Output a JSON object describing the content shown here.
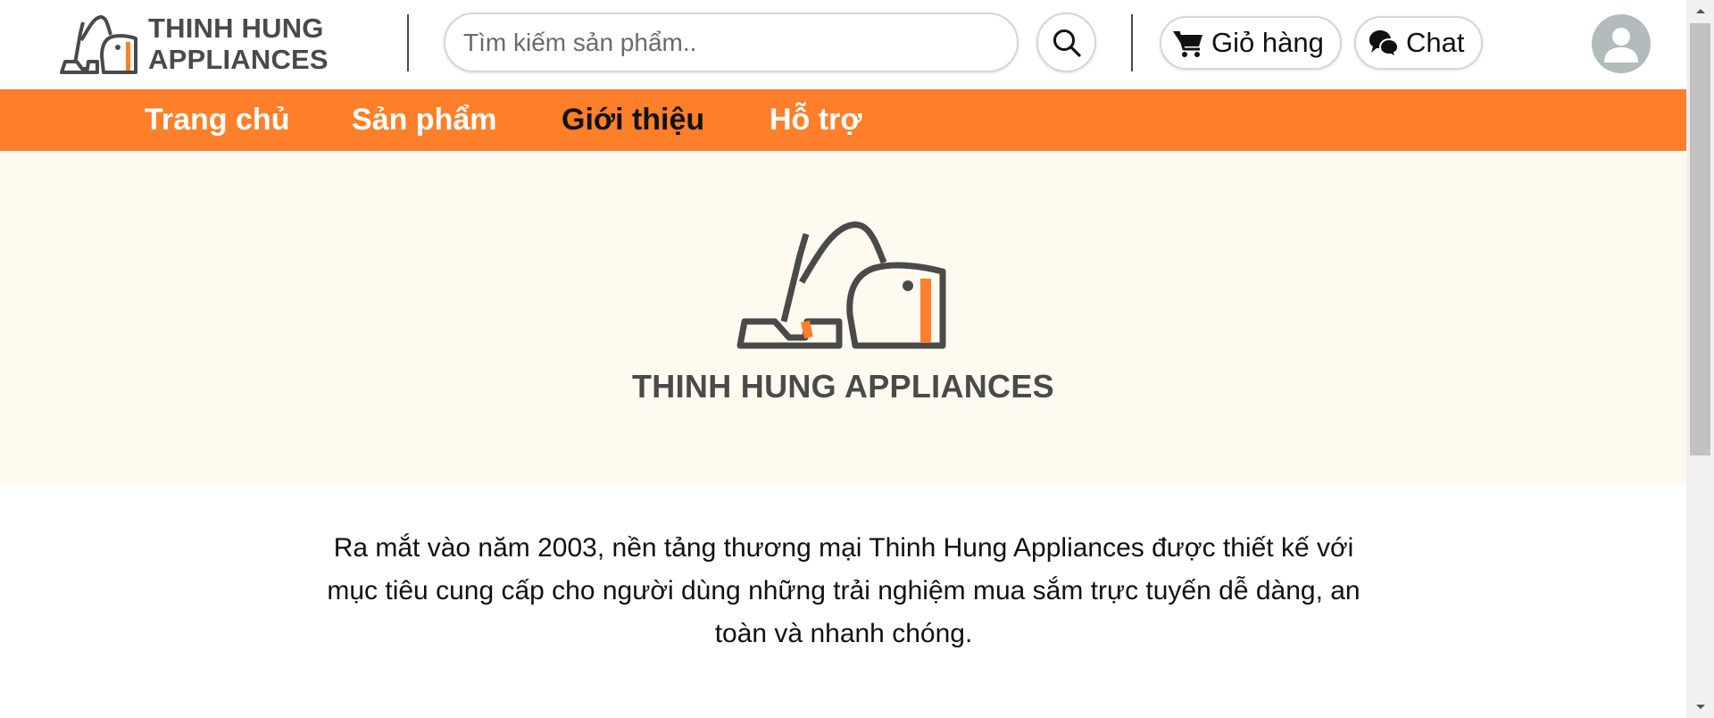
{
  "header": {
    "brand_line1": "THINH HUNG",
    "brand_line2": "APPLIANCES",
    "search": {
      "placeholder": "Tìm kiếm sản phẩm.."
    },
    "cart_label": "Giỏ hàng",
    "chat_label": "Chat"
  },
  "nav": {
    "items": [
      {
        "label": "Trang chủ",
        "active": false
      },
      {
        "label": "Sản phẩm",
        "active": false
      },
      {
        "label": "Giới thiệu",
        "active": true
      },
      {
        "label": "Hỗ trợ",
        "active": false
      }
    ]
  },
  "hero": {
    "title": "THINH HUNG APPLIANCES"
  },
  "intro": {
    "text": "Ra mắt vào năm 2003, nền tảng thương mại Thinh Hung Appliances được thiết kế với mục tiêu cung cấp cho người dùng những trải nghiệm mua sắm trực tuyến dễ dàng, an toàn và nhanh chóng."
  },
  "colors": {
    "accent": "#ff7f2a",
    "hero_bg": "#fffaf0",
    "logo_gray": "#4a4a4a",
    "active_nav": "#111111"
  },
  "icons": {
    "logo": "vacuum-cleaner-logo",
    "search": "search-icon",
    "cart": "cart-icon",
    "chat": "chat-bubbles-icon",
    "avatar": "user-avatar-icon"
  }
}
